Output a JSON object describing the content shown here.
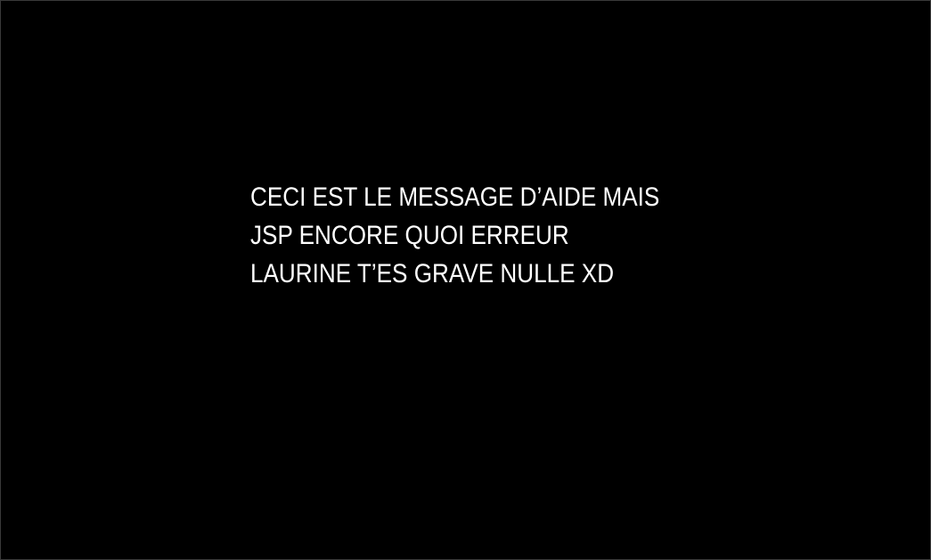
{
  "help_message": {
    "lines": [
      "CECI EST LE MESSAGE D’AIDE MAIS",
      "JSP ENCORE QUOI ERREUR",
      "LAURINE T’ES GRAVE NULLE XD"
    ]
  },
  "colors": {
    "background": "#000000",
    "text": "#ffffff",
    "border": "#3a3a3a"
  }
}
